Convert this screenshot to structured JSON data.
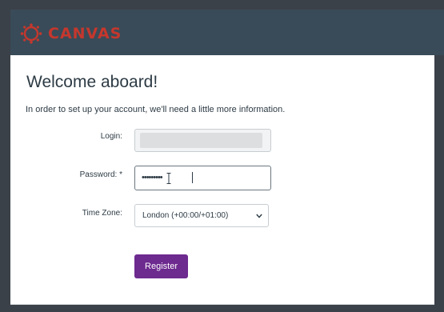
{
  "header": {
    "brand": "CANVAS",
    "brand_color": "#c5372d",
    "bar_color": "#394b58",
    "logo_icon": "canvas-logo-icon"
  },
  "main": {
    "title": "Welcome aboard!",
    "intro": "In order to set up your account, we'll need a little more information."
  },
  "form": {
    "login": {
      "label": "Login:",
      "value": ""
    },
    "password": {
      "label": "Password: *",
      "masked_value": "•••••••••"
    },
    "timezone": {
      "label": "Time Zone:",
      "selected": "London (+00:00/+01:00)"
    },
    "register_label": "Register",
    "button_color": "#6d2a8f"
  }
}
